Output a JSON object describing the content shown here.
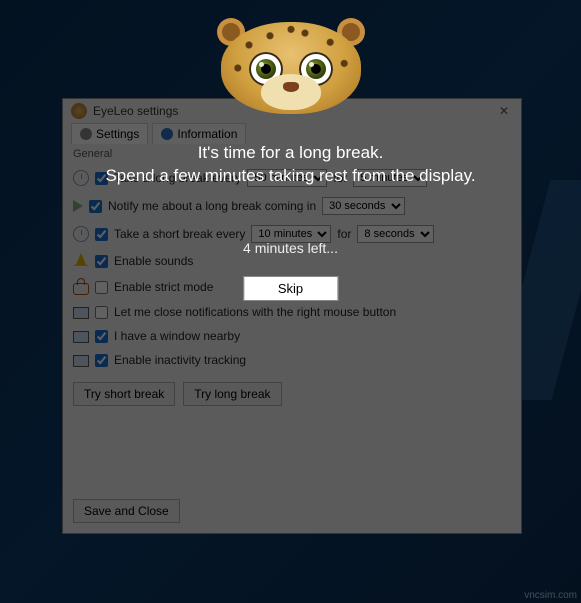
{
  "window": {
    "title": "EyeLeo settings"
  },
  "tabs": [
    "Settings",
    "Information"
  ],
  "groups": {
    "general": "General"
  },
  "settings": {
    "long_break": {
      "label": "Take a long break every",
      "interval": "50 minutes",
      "for_word": "for",
      "duration": "5 minutes",
      "checked": true
    },
    "notify": {
      "label": "Notify me about a long break coming in",
      "lead": "30 seconds",
      "checked": true
    },
    "short_break": {
      "label": "Take a short break every",
      "interval": "10 minutes",
      "for_word": "for",
      "duration": "8 seconds",
      "checked": true
    },
    "sounds": {
      "label": "Enable sounds",
      "checked": true
    },
    "strict": {
      "label": "Enable strict mode",
      "checked": false
    },
    "close_right": {
      "label": "Let me close notifications with the right mouse button",
      "checked": false
    },
    "window_nearby": {
      "label": "I have a window nearby",
      "checked": true
    },
    "inactivity": {
      "label": "Enable inactivity tracking",
      "checked": true
    }
  },
  "buttons": {
    "try_short": "Try short break",
    "try_long": "Try long break",
    "save_close": "Save and Close"
  },
  "overlay": {
    "line1": "It's time for a long break.",
    "line2": "Spend a few minutes taking rest from the display.",
    "countdown": "4 minutes left...",
    "skip": "Skip"
  },
  "watermark": "vncsim.com"
}
